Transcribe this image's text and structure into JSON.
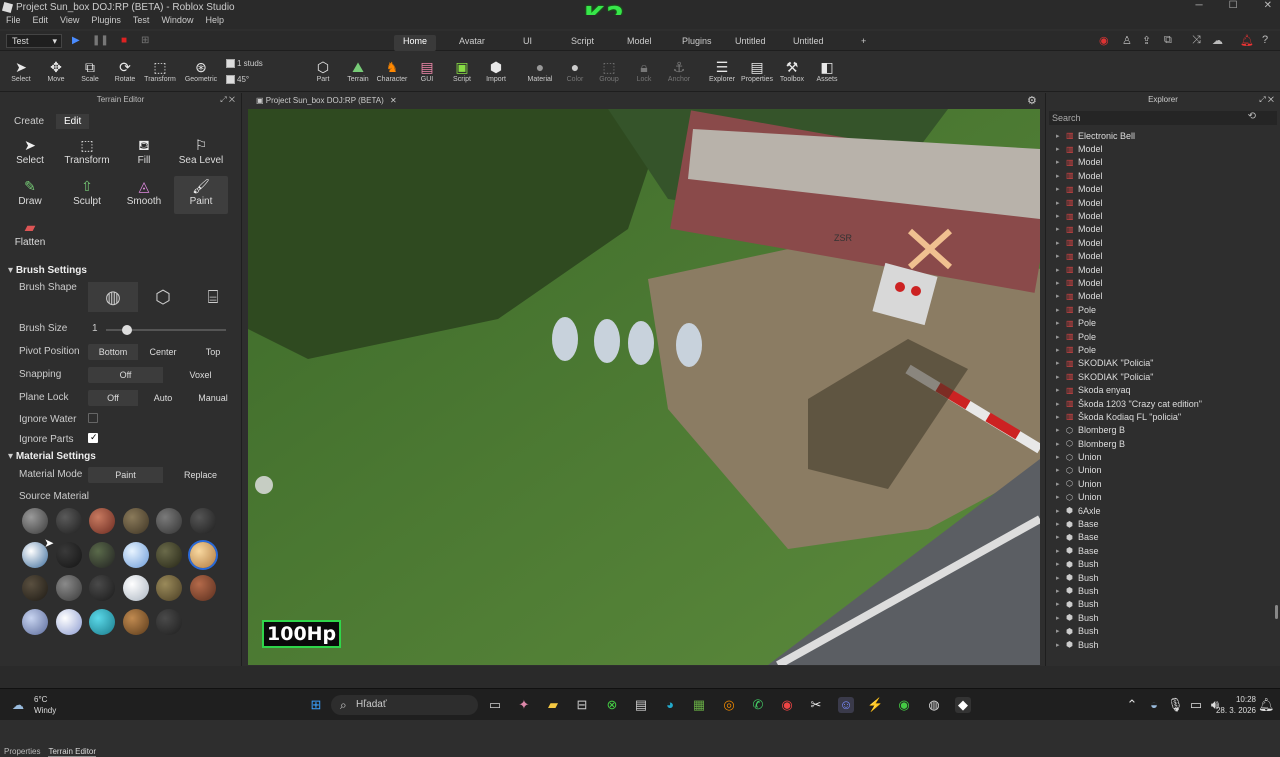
{
  "window": {
    "title": "Project Sun_box DOJ:RP (BETA) - Roblox Studio"
  },
  "menu": [
    "File",
    "Edit",
    "View",
    "Plugins",
    "Test",
    "Window",
    "Help"
  ],
  "logo_text": "K2",
  "play": {
    "mode": "Test"
  },
  "ribbon_tabs": [
    "Home",
    "Avatar",
    "UI",
    "Script",
    "Model",
    "Plugins",
    "Untitled",
    "Untitled",
    "+"
  ],
  "active_tab": "Home",
  "toolbar": {
    "select": "Select",
    "move": "Move",
    "scale": "Scale",
    "rotate": "Rotate",
    "transform": "Transform",
    "geometric": "Geometric",
    "grid1": "1 studs",
    "grid2": "45°",
    "part": "Part",
    "terrain": "Terrain",
    "character": "Character",
    "gui": "GUI",
    "script": "Script",
    "import": "Import",
    "material": "Material",
    "color": "Color",
    "group": "Group",
    "lock": "Lock",
    "anchor": "Anchor",
    "explorer": "Explorer",
    "properties": "Properties",
    "toolbox": "Toolbox",
    "assets": "Assets"
  },
  "terrain_editor": {
    "title": "Terrain Editor",
    "tabs": [
      "Create",
      "Edit"
    ],
    "active_tab": "Edit",
    "tools": [
      "Select",
      "Transform",
      "Fill",
      "Sea Level",
      "Draw",
      "Sculpt",
      "Smooth",
      "Paint",
      "Flatten"
    ],
    "active_tool": "Paint",
    "brush_settings": {
      "title": "Brush Settings",
      "brush_shape": "Brush Shape",
      "brush_size": "Brush Size",
      "brush_size_value": "1",
      "brush_size_fraction": 0.1,
      "pivot_position": "Pivot Position",
      "pivot_options": [
        "Bottom",
        "Center",
        "Top"
      ],
      "snapping": "Snapping",
      "snapping_options": [
        "Off",
        "Voxel"
      ],
      "plane_lock": "Plane Lock",
      "plane_lock_options": [
        "Off",
        "Auto",
        "Manual"
      ],
      "ignore_water": "Ignore Water",
      "ignore_parts": "Ignore Parts"
    },
    "material_settings": {
      "title": "Material Settings",
      "material_mode": "Material Mode",
      "mode_options": [
        "Paint",
        "Replace"
      ],
      "source_material": "Source Material"
    }
  },
  "bottom_tabs": [
    "Properties",
    "Terrain Editor"
  ],
  "viewport": {
    "tab": "Project Sun_box DOJ:RP (BETA)",
    "hud_hp": "100Hp",
    "sign_text": "ZSR"
  },
  "explorer": {
    "title": "Explorer",
    "search_placeholder": "Search",
    "items": [
      "Electronic Bell",
      "Model",
      "Model",
      "Model",
      "Model",
      "Model",
      "Model",
      "Model",
      "Model",
      "Model",
      "Model",
      "Model",
      "Model",
      "Pole",
      "Pole",
      "Pole",
      "Pole",
      "SKODIAK \"Policia\"",
      "SKODIAK \"Policia\"",
      "Skoda enyaq",
      "Škoda 1203 \"Crazy cat edition\"",
      "Škoda Kodiaq FL \"policia\"",
      "Blomberg B",
      "Blomberg B",
      "Union",
      "Union",
      "Union",
      "Union",
      "6Axle",
      "Base",
      "Base",
      "Base",
      "Bush",
      "Bush",
      "Bush",
      "Bush",
      "Bush",
      "Bush",
      "Bush"
    ]
  },
  "taskbar": {
    "weather_temp": "6°C",
    "weather_desc": "Windy",
    "search": "Hľadať",
    "time": "10:28",
    "date": "28. 3. 2026"
  }
}
